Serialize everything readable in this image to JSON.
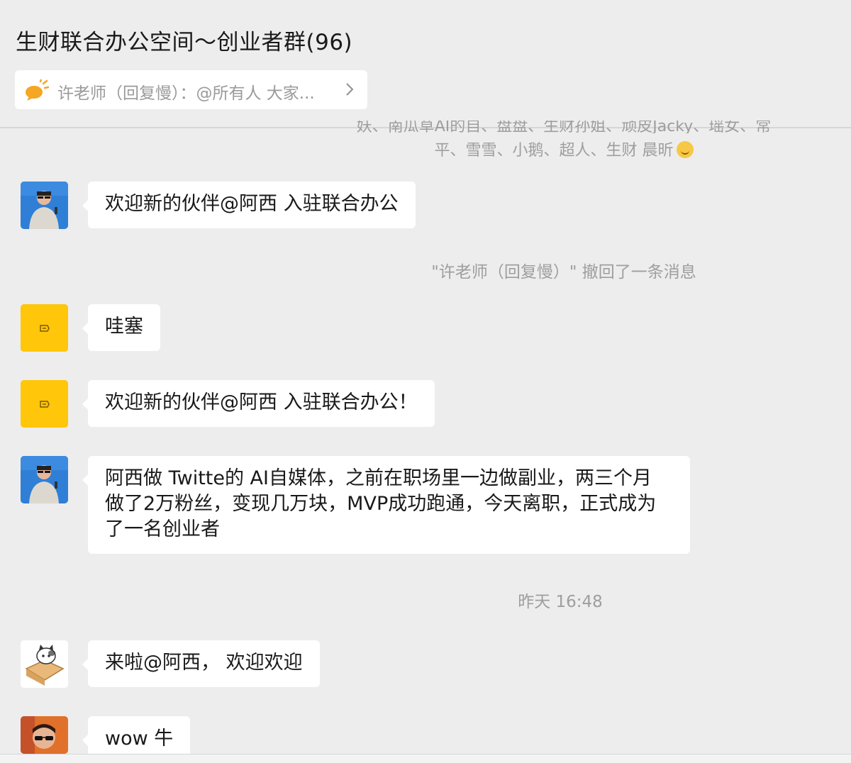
{
  "header": {
    "title": "生财联合办公空间～创业者群(96)",
    "pinned_notice": "许老师（回复慢）：@所有人 大家..."
  },
  "system": {
    "clipped_line": "妖、南瓜草AI的自、盘盘、生财孙姐、顽皮Jacky、瑶女、常",
    "join_notice_line2": "平、雪雪、小鹅、超人、生财 晨昕",
    "recall_notice": "\"许老师（回复慢）\" 撤回了一条消息",
    "timestamp": "昨天 16:48"
  },
  "messages": [
    {
      "avatar": "man-photo-avatar",
      "lines": [
        "欢迎新的伙伴@阿西 入驻联合办公"
      ]
    },
    {
      "avatar": "yellow-logo-avatar",
      "lines": [
        "哇塞"
      ]
    },
    {
      "avatar": "yellow-logo-avatar",
      "lines": [
        "欢迎新的伙伴@阿西 入驻联合办公！"
      ]
    },
    {
      "avatar": "man-photo-avatar",
      "lines": [
        "阿西做 Twitte的 AI自媒体，之前在职场里一边做副业，两三个月",
        "做了2万粉丝，变现几万块，MVP成功跑通，今天离职，正式成为",
        "了一名创业者"
      ]
    },
    {
      "avatar": "cat-box-avatar",
      "lines": [
        "来啦@阿西， 欢迎欢迎"
      ]
    },
    {
      "avatar": "sunglasses-avatar",
      "lines": [
        "wow 牛"
      ]
    }
  ],
  "colors": {
    "background": "#ededed",
    "bubble": "#ffffff",
    "system_text": "#9e9e9e",
    "brand_yellow": "#ffc60a"
  }
}
